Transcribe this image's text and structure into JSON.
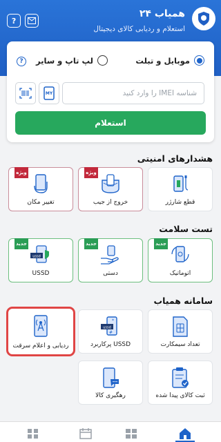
{
  "header": {
    "title": "همیاب ۲۴",
    "subtitle": "استعلام و ردیابی کالای دیجیتال"
  },
  "card": {
    "radio_mobile": "موبایل و تبلت",
    "radio_laptop": "لپ تاپ و سایر",
    "imei_placeholder": "شناسه IMEI را وارد کنید",
    "my_label": "MY",
    "submit_label": "استعلام"
  },
  "sections": {
    "alerts": {
      "title": "هشدارهای امنیتی",
      "items": [
        {
          "label": "قطع شارژر"
        },
        {
          "label": "خروج از جیب",
          "badge": "ویژه"
        },
        {
          "label": "تغییر مکان",
          "badge": "ویژه"
        }
      ]
    },
    "health": {
      "title": "تست سلامت",
      "items": [
        {
          "label": "اتوماتیک",
          "badge": "جدید"
        },
        {
          "label": "دستی",
          "badge": "جدید"
        },
        {
          "label": "USSD",
          "badge": "جدید"
        }
      ]
    },
    "system": {
      "title": "سامانه همیاب",
      "items": [
        {
          "label": "تعداد سیمکارت"
        },
        {
          "label": "USSD پرکاربرد"
        },
        {
          "label": "ردیابی و اعلام سرقت"
        },
        {
          "label": "ثبت کالای پیدا شده"
        },
        {
          "label": "رهگیری کالا"
        }
      ]
    }
  },
  "colors": {
    "primary": "#1f5fc4",
    "green": "#27a85d",
    "alert_badge": "#c2283b",
    "health_badge": "#2a9d55",
    "selected": "#e04545"
  },
  "icons": {
    "help": "help-icon",
    "home": "home-icon"
  }
}
